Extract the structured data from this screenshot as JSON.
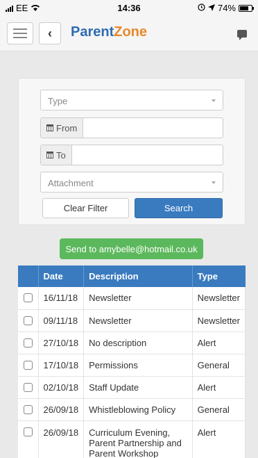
{
  "status_bar": {
    "carrier": "EE",
    "time": "14:36",
    "battery": "74%",
    "battery_level": 0.74
  },
  "header": {
    "logo_part1": "Parent",
    "logo_part2": "Zone"
  },
  "filter": {
    "type_placeholder": "Type",
    "from_label": "From",
    "from_value": "",
    "to_label": "To",
    "to_value": "",
    "attachment_placeholder": "Attachment",
    "clear_label": "Clear Filter",
    "search_label": "Search"
  },
  "send_button": "Send to amybelle@hotmail.co.uk",
  "table": {
    "headers": [
      "Date",
      "Description",
      "Type"
    ],
    "rows": [
      {
        "date": "16/11/18",
        "description": "Newsletter",
        "type": "Newsletter"
      },
      {
        "date": "09/11/18",
        "description": "Newsletter",
        "type": "Newsletter"
      },
      {
        "date": "27/10/18",
        "description": "No description",
        "type": "Alert"
      },
      {
        "date": "17/10/18",
        "description": "Permissions",
        "type": "General"
      },
      {
        "date": "02/10/18",
        "description": "Staff Update",
        "type": "Alert"
      },
      {
        "date": "26/09/18",
        "description": "Whistleblowing Policy",
        "type": "General"
      },
      {
        "date": "26/09/18",
        "description": "Curriculum Evening, Parent Partnership and Parent Workshop",
        "type": "Alert"
      }
    ]
  },
  "colors": {
    "primary": "#3a7bbf",
    "success": "#5cb85c",
    "brand_blue": "#2e6bb3",
    "brand_orange": "#e8892a"
  }
}
